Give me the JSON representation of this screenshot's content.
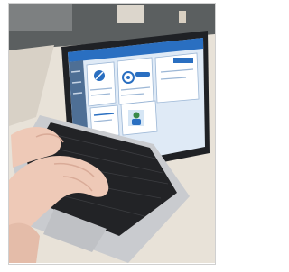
{
  "photo": {
    "subject": "hands-typing-on-laptop",
    "colors": {
      "wall": "#5b5f60",
      "table": "#e8e2d8",
      "floor": "#b9b2a8",
      "laptop_body": "#c9cbcf",
      "laptop_bezel": "#1f2125",
      "keyboard": "#222326",
      "screen_bg": "#dfeaf6",
      "screen_header": "#2a6fc1",
      "screen_sidebar": "#4e6f95",
      "skin": "#eec9b7",
      "skin_shadow": "#d9ab98"
    },
    "icons": [
      "pen-card-icon",
      "gear-card-icon",
      "person-card-icon"
    ]
  }
}
